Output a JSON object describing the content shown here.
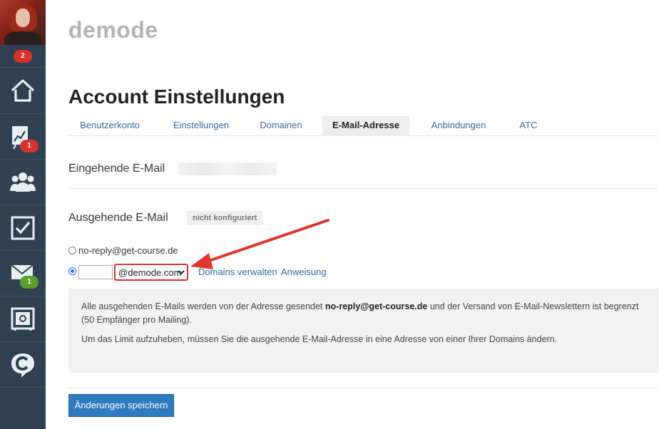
{
  "sidebar": {
    "avatar_badge": "2",
    "items": [
      {
        "icon": "home-icon",
        "badge": ""
      },
      {
        "icon": "chart-board-icon",
        "badge": "1"
      },
      {
        "icon": "users-icon",
        "badge": ""
      },
      {
        "icon": "checkbox-icon",
        "badge": ""
      },
      {
        "icon": "mail-icon",
        "badge": "1"
      },
      {
        "icon": "safe-icon",
        "badge": ""
      },
      {
        "icon": "getcourse-logo-icon",
        "badge": ""
      }
    ]
  },
  "brand": "demode",
  "page_title": "Account Einstellungen",
  "tabs": [
    {
      "label": "Benutzerkonto",
      "active": false
    },
    {
      "label": "Einstellungen",
      "active": false
    },
    {
      "label": "Domainen",
      "active": false
    },
    {
      "label": "E-Mail-Adresse",
      "active": true
    },
    {
      "label": "Anbindungen",
      "active": false
    },
    {
      "label": "ATC",
      "active": false
    }
  ],
  "incoming": {
    "title": "Eingehende E-Mail"
  },
  "outgoing": {
    "title": "Ausgehende E-Mail",
    "status": "nicht konfiguriert",
    "option_default": "no-reply@get-course.de",
    "local_part_value": "",
    "domain_selected": "@demode.com",
    "link_manage": "Domains verwalten",
    "link_instructions": "Anweisung"
  },
  "info": {
    "p1_before": "Alle ausgehenden E-Mails werden von der Adresse gesendet ",
    "p1_bold": "no-reply@get-course.de",
    "p1_after": " und der Versand von E-Mail-Newslettern ist begrenzt (50 Empfänger pro Mailing).",
    "p2": "Um das Limit aufzuheben, müssen Sie die ausgehende E-Mail-Adresse in eine Adresse von einer Ihrer Domains ändern."
  },
  "save_button": "Änderungen speichern",
  "colors": {
    "sidebar": "#2f4050",
    "accent": "#2f7bbf",
    "badge_red": "#d9312b",
    "badge_green": "#5aa02c",
    "highlight": "#d9312b"
  }
}
